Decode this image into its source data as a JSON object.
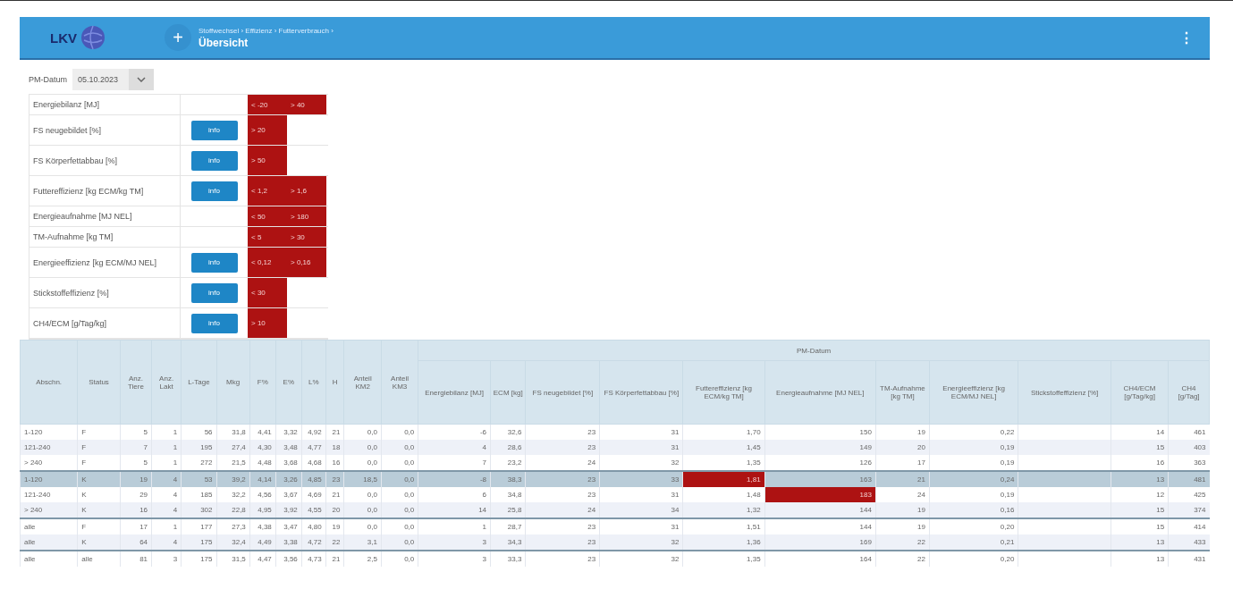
{
  "header": {
    "logo": "LKV",
    "add_button": "+",
    "breadcrumb": "Stoffwechsel › Effizienz › Futterverbrauch ›",
    "title": "Übersicht",
    "menu": "⋮"
  },
  "date_filter": {
    "label": "PM-Datum",
    "value": "05.10.2023"
  },
  "thresholds": [
    {
      "label": "Energiebilanz [MJ]",
      "limits": [
        "< -20",
        "> 40"
      ]
    },
    {
      "label": "FS neugebildet [%]",
      "info": "info",
      "limits": [
        "> 20"
      ]
    },
    {
      "label": "FS Körperfettabbau [%]",
      "info": "info",
      "limits": [
        "> 50"
      ]
    },
    {
      "label": "Futtereffizienz [kg ECM/kg TM]",
      "info": "info",
      "limits": [
        "< 1,2",
        "> 1,6"
      ]
    },
    {
      "label": "Energieaufnahme [MJ NEL]",
      "limits": [
        "< 50",
        "> 180"
      ]
    },
    {
      "label": "TM-Aufnahme [kg TM]",
      "limits": [
        "< 5",
        "> 30"
      ]
    },
    {
      "label": "Energieeffizienz [kg ECM/MJ NEL]",
      "info": "info",
      "limits": [
        "< 0,12",
        "> 0,16"
      ]
    },
    {
      "label": "Stickstoffeffizienz [%]",
      "info": "info",
      "limits": [
        "< 30"
      ]
    },
    {
      "label": "CH4/ECM [g/Tag/kg]",
      "info": "info",
      "limits": [
        "> 10"
      ]
    }
  ],
  "table": {
    "group_heading": "PM-Datum",
    "columns": [
      "Abschn.",
      "Status",
      "Anz. Tiere",
      "Anz. Lakt",
      "L-Tage",
      "Mkg",
      "F%",
      "E%",
      "L%",
      "H",
      "Anteil KM2",
      "Anteil KM3"
    ],
    "group_columns": [
      "Energiebilanz [MJ]",
      "ECM [kg]",
      "FS neugebildet [%]",
      "FS Körperfettabbau [%]",
      "Futtereffizienz [kg ECM/kg TM]",
      "Energieaufnahme [MJ NEL]",
      "TM-Aufnahme [kg TM]",
      "Energieeffizienz [kg ECM/MJ NEL]",
      "Stickstoffeffizienz [%]",
      "CH4/ECM [g/Tag/kg]",
      "CH4 [g/Tag]"
    ],
    "rows": [
      {
        "selected": false,
        "divider_above": false,
        "cells": [
          "1-120",
          "F",
          "5",
          "1",
          "56",
          "31,8",
          "4,41",
          "3,32",
          "4,92",
          "21",
          "0,0",
          "0,0",
          "-6",
          "32,6",
          "23",
          "31",
          "1,70",
          "150",
          "19",
          "0,22",
          "",
          "14",
          "461"
        ]
      },
      {
        "selected": false,
        "divider_above": false,
        "cells": [
          "121-240",
          "F",
          "7",
          "1",
          "195",
          "27,4",
          "4,30",
          "3,48",
          "4,77",
          "18",
          "0,0",
          "0,0",
          "4",
          "28,6",
          "23",
          "31",
          "1,45",
          "149",
          "20",
          "0,19",
          "",
          "15",
          "403"
        ]
      },
      {
        "selected": false,
        "divider_above": false,
        "cells": [
          "> 240",
          "F",
          "5",
          "1",
          "272",
          "21,5",
          "4,48",
          "3,68",
          "4,68",
          "16",
          "0,0",
          "0,0",
          "7",
          "23,2",
          "24",
          "32",
          "1,35",
          "126",
          "17",
          "0,19",
          "",
          "16",
          "363"
        ]
      },
      {
        "selected": true,
        "divider_above": true,
        "cells": [
          "1-120",
          "K",
          "19",
          "4",
          "53",
          "39,2",
          "4,14",
          "3,26",
          "4,85",
          "23",
          "18,5",
          "0,0",
          "-8",
          "38,3",
          "23",
          "33",
          {
            "text": "1,81",
            "alert": true
          },
          "163",
          "21",
          "0,24",
          "",
          "13",
          "481"
        ]
      },
      {
        "selected": false,
        "divider_above": false,
        "cells": [
          "121-240",
          "K",
          "29",
          "4",
          "185",
          "32,2",
          "4,56",
          "3,67",
          "4,69",
          "21",
          "0,0",
          "0,0",
          "6",
          "34,8",
          "23",
          "31",
          "1,48",
          {
            "text": "183",
            "alert": true
          },
          "24",
          "0,19",
          "",
          "12",
          "425"
        ]
      },
      {
        "selected": false,
        "divider_above": false,
        "cells": [
          "> 240",
          "K",
          "16",
          "4",
          "302",
          "22,8",
          "4,95",
          "3,92",
          "4,55",
          "20",
          "0,0",
          "0,0",
          "14",
          "25,8",
          "24",
          "34",
          "1,32",
          "144",
          "19",
          "0,16",
          "",
          "15",
          "374"
        ]
      },
      {
        "selected": false,
        "divider_above": true,
        "cells": [
          "alle",
          "F",
          "17",
          "1",
          "177",
          "27,3",
          "4,38",
          "3,47",
          "4,80",
          "19",
          "0,0",
          "0,0",
          "1",
          "28,7",
          "23",
          "31",
          "1,51",
          "144",
          "19",
          "0,20",
          "",
          "15",
          "414"
        ]
      },
      {
        "selected": false,
        "divider_above": false,
        "cells": [
          "alle",
          "K",
          "64",
          "4",
          "175",
          "32,4",
          "4,49",
          "3,38",
          "4,72",
          "22",
          "3,1",
          "0,0",
          "3",
          "34,3",
          "23",
          "32",
          "1,36",
          "169",
          "22",
          "0,21",
          "",
          "13",
          "433"
        ]
      },
      {
        "selected": false,
        "divider_above": true,
        "cells": [
          "alle",
          "alle",
          "81",
          "3",
          "175",
          "31,5",
          "4,47",
          "3,56",
          "4,73",
          "21",
          "2,5",
          "0,0",
          "3",
          "33,3",
          "23",
          "32",
          "1,35",
          "164",
          "22",
          "0,20",
          "",
          "13",
          "431"
        ]
      }
    ]
  }
}
